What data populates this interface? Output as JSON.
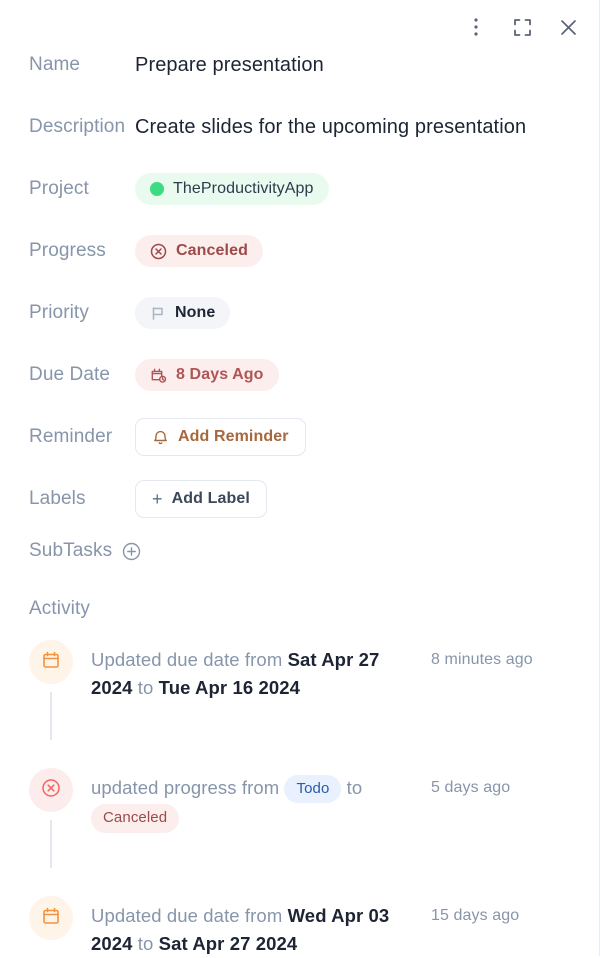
{
  "window_controls": [
    {
      "name": "more-options",
      "icon": "kebab-menu-icon",
      "title": "More options"
    },
    {
      "name": "expand",
      "icon": "expand-icon",
      "title": "Expand"
    },
    {
      "name": "close",
      "icon": "close-icon",
      "title": "Close"
    }
  ],
  "fields": {
    "name": {
      "label": "Name",
      "value": "Prepare presentation"
    },
    "description": {
      "label": "Description",
      "value": "Create slides for the upcoming presentation"
    },
    "project": {
      "label": "Project",
      "value": "TheProductivityApp",
      "dot_color": "#3ddc84",
      "bg_color": "#e9fbef"
    },
    "progress": {
      "label": "Progress",
      "value": "Canceled",
      "icon": "x-circle-icon",
      "bg_color": "#fdeeee",
      "text_color": "#9c4a4a"
    },
    "priority": {
      "label": "Priority",
      "value": "None",
      "icon": "flag-icon",
      "bg_color": "#f3f5f8",
      "text_color": "#1d2433"
    },
    "due_date": {
      "label": "Due Date",
      "value": "8 Days Ago",
      "icon": "calendar-clock-icon",
      "bg_color": "#fdeeee",
      "text_color": "#b05555"
    },
    "reminder": {
      "label": "Reminder",
      "button_label": "Add Reminder",
      "icon": "bell-icon",
      "text_color": "#a6693f"
    },
    "labels": {
      "label": "Labels",
      "button_label": "Add Label",
      "icon": "plus-icon",
      "text_color": "#3c4758"
    }
  },
  "subtasks": {
    "label": "SubTasks",
    "add_icon": "plus-circle-icon"
  },
  "activity": {
    "title": "Activity",
    "items": [
      {
        "icon": "calendar-icon",
        "icon_type": "calendar",
        "prefix": "Updated due date from ",
        "from": "Sat Apr 27 2024",
        "middle": " to ",
        "to": "Tue Apr 16 2024",
        "time": "8 minutes ago"
      },
      {
        "icon": "x-circle-icon",
        "icon_type": "cancel",
        "prefix": "updated progress from ",
        "from": "Todo",
        "middle": " to ",
        "to": "Canceled",
        "time": "5 days ago",
        "pill_style": true,
        "from_pill_class": "mini-todo",
        "to_pill_class": "mini-canceled"
      },
      {
        "icon": "calendar-icon",
        "icon_type": "calendar",
        "prefix": "Updated due date from ",
        "from": "Wed Apr 03 2024",
        "middle": " to ",
        "to": "Sat Apr 27 2024",
        "time": "15 days ago"
      }
    ]
  }
}
